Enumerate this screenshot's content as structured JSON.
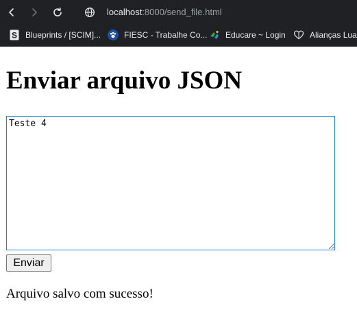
{
  "browser": {
    "address_bar": {
      "host": "localhost",
      "rest": ":8000/send_file.html"
    },
    "bookmarks": [
      {
        "label": "Blueprints / [SCIM]...",
        "icon": "dark-s-favicon-icon"
      },
      {
        "label": "FIESC - Trabalhe Co...",
        "icon": "paw-favicon-icon"
      },
      {
        "label": "Educare ~ Login",
        "icon": "educare-favicon-icon"
      },
      {
        "label": "Alianças Luar",
        "icon": "heart-favicon-icon"
      }
    ],
    "colors": {
      "chrome_background": "#202124",
      "text": "#e8eaed",
      "url_dim": "#9aa0a6"
    }
  },
  "page": {
    "title": "Enviar arquivo JSON",
    "textarea_value": "Teste 4",
    "send_button_label": "Enviar",
    "status_message": "Arquivo salvo com sucesso!",
    "colors": {
      "textarea_focus_border": "#1a86c9",
      "button_background": "#efefef"
    }
  }
}
